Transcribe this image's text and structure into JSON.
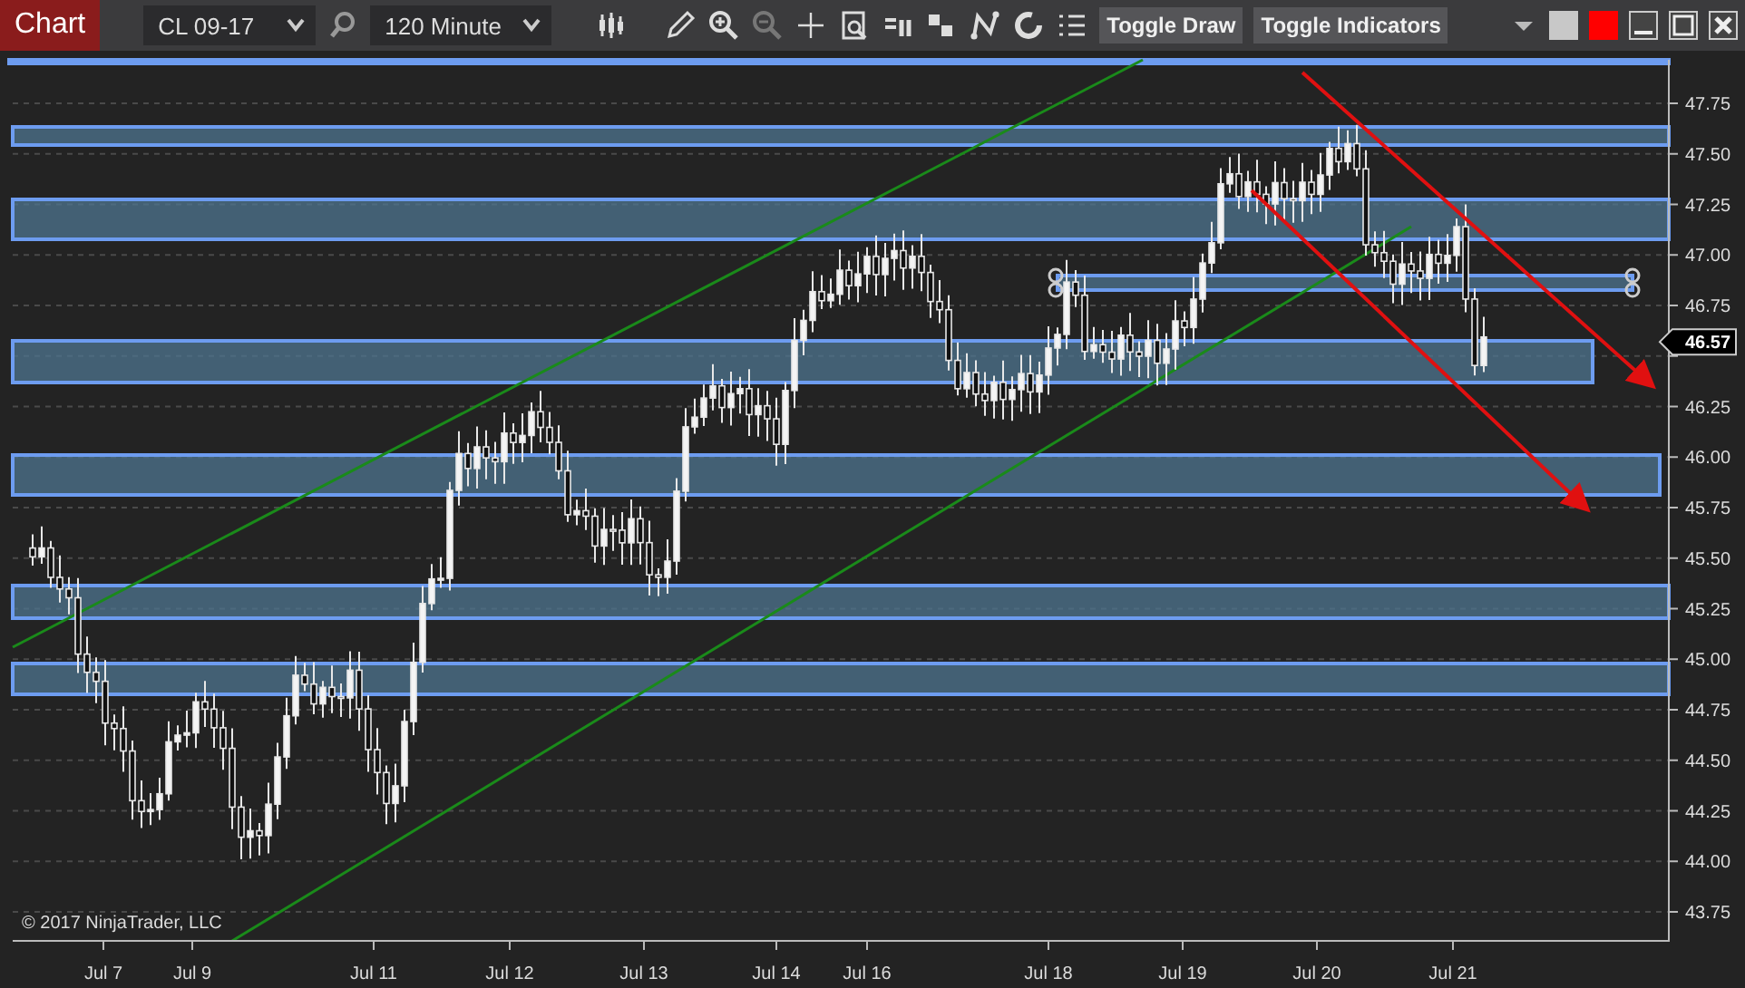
{
  "toolbar": {
    "chart_tab": "Chart",
    "instrument": "CL 09-17",
    "interval": "120 Minute",
    "buttons": [
      "Toggle Draw",
      "Toggle Indicators"
    ]
  },
  "price_axis": {
    "ticks_above_price": [
      "47.75",
      "47.50",
      "47.25",
      "47.00",
      "46.75"
    ],
    "ticks_below_price": [
      "46.25",
      "46.00",
      "45.75",
      "45.50",
      "45.25",
      "45.00",
      "44.75",
      "44.50",
      "44.25",
      "44.00",
      "43.75"
    ],
    "current_price": "46.57"
  },
  "time_axis": {
    "labels": [
      "Jul 7",
      "Jul 9",
      "Jul 11",
      "Jul 12",
      "Jul 13",
      "Jul 14",
      "Jul 16",
      "Jul 18",
      "Jul 19",
      "Jul 20",
      "Jul 21"
    ]
  },
  "copyright": "© 2017 NinjaTrader, LLC"
}
